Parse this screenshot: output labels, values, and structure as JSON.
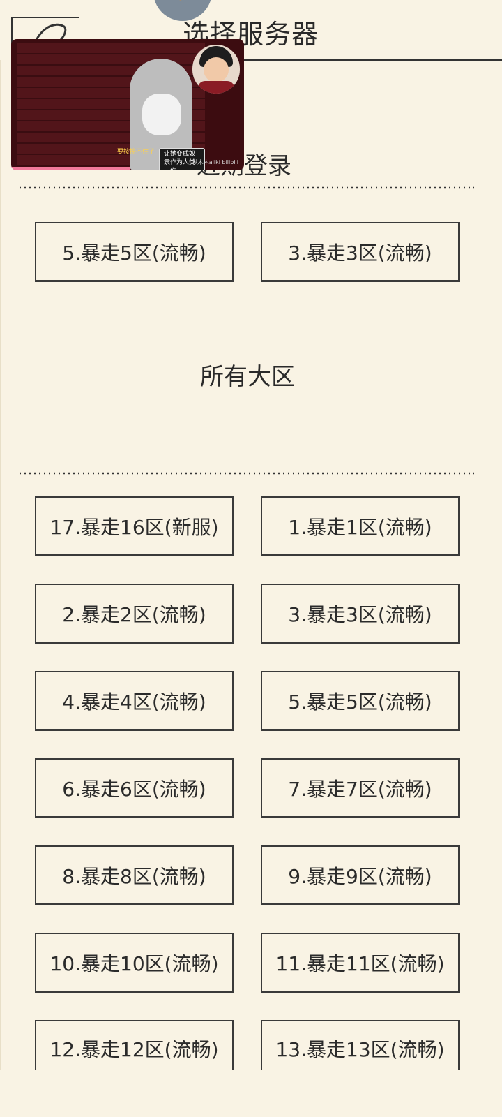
{
  "header": {
    "title": "选择服务器"
  },
  "recent": {
    "heading": "近期登录",
    "servers": [
      "5.暴走5区(流畅)",
      "3.暴走3区(流畅)"
    ]
  },
  "all": {
    "heading": "所有大区",
    "servers": [
      "17.暴走16区(新服)",
      "1.暴走1区(流畅)",
      "2.暴走2区(流畅)",
      "3.暴走3区(流畅)",
      "4.暴走4区(流畅)",
      "5.暴走5区(流畅)",
      "6.暴走6区(流畅)",
      "7.暴走7区(流畅)",
      "8.暴走8区(流畅)",
      "9.暴走9区(流畅)",
      "10.暴走10区(流畅)",
      "11.暴走11区(流畅)",
      "12.暴走12区(流畅)",
      "13.暴走13区(流畅)"
    ]
  },
  "video_overlay": {
    "bubble_text": "让她变成奴隶作为人类工作",
    "subtitle": "要按捺不住了",
    "watermark": "秋木木aliki bilibili"
  },
  "colors": {
    "background": "#f9f3e4",
    "ink": "#2b2b2b"
  }
}
